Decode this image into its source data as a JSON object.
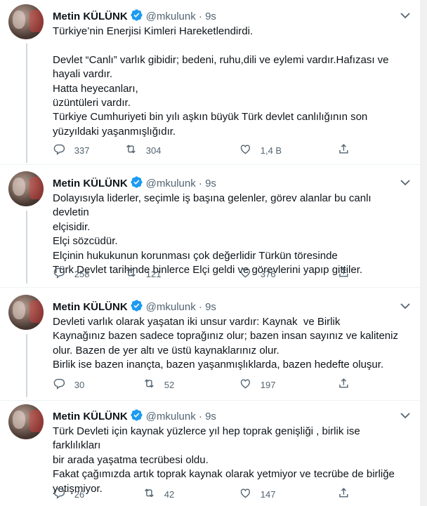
{
  "accent_color": "#1d9bf0",
  "tweets": [
    {
      "author": {
        "name": "Metin KÜLÜNK",
        "handle": "@mkulunk",
        "separator": "·",
        "time": "9s"
      },
      "lines": [
        "Türkiye’nin Enerjisi Kimleri Hareketlendirdi.",
        " ",
        "Devlet “Canlı” varlık gibidir; bedeni, ruhu,dili ve eylemi vardır.Hafızası ve",
        "hayali vardır.",
        "Hatta heyecanları,",
        "üzüntüleri vardır.",
        "Türkiye Cumhuriyeti bin yılı aşkın büyük Türk devlet canlılığının son",
        "yüzyıldaki yaşanmışlığıdır."
      ],
      "replies": "337",
      "retweets": "304",
      "likes": "1,4 B"
    },
    {
      "author": {
        "name": "Metin KÜLÜNK",
        "handle": "@mkulunk",
        "separator": "·",
        "time": "9s"
      },
      "lines": [
        "Dolayısıyla liderler, seçimle iş başına gelenler, görev alanlar bu canlı devletin",
        "elçisidir.",
        "Elçi sözcüdür.",
        "Elçinin hukukunun korunması çok değerlidir Türkün töresinde",
        "Türk Devlet tarihinde binlerce Elçi geldi ve görevlerini yapıp gittiler."
      ],
      "replies": "258",
      "retweets": "121",
      "likes": "376"
    },
    {
      "author": {
        "name": "Metin KÜLÜNK",
        "handle": "@mkulunk",
        "separator": "·",
        "time": "9s"
      },
      "lines": [
        "Devleti varlık olarak yaşatan iki unsur vardır: Kaynak  ve Birlik",
        "Kaynağınız bazen sadece toprağınız olur; bazen insan sayınız ve kaliteniz",
        "olur. Bazen de yer altı ve üstü kaynaklarınız olur.",
        "Birlik ise bazen inançta, bazen yaşanmışlıklarda, bazen hedefte oluşur."
      ],
      "replies": "30",
      "retweets": "52",
      "likes": "197"
    },
    {
      "author": {
        "name": "Metin KÜLÜNK",
        "handle": "@mkulunk",
        "separator": "·",
        "time": "9s"
      },
      "lines": [
        "Türk Devleti için kaynak yüzlerce yıl hep toprak genişliği , birlik ise farklılıkları",
        "bir arada yaşatma tecrübesi oldu.",
        "Fakat çağımızda artık toprak kaynak olarak yetmiyor ve tecrübe de birliğe",
        "yetişmiyor."
      ],
      "replies": "26",
      "retweets": "42",
      "likes": "147"
    }
  ]
}
